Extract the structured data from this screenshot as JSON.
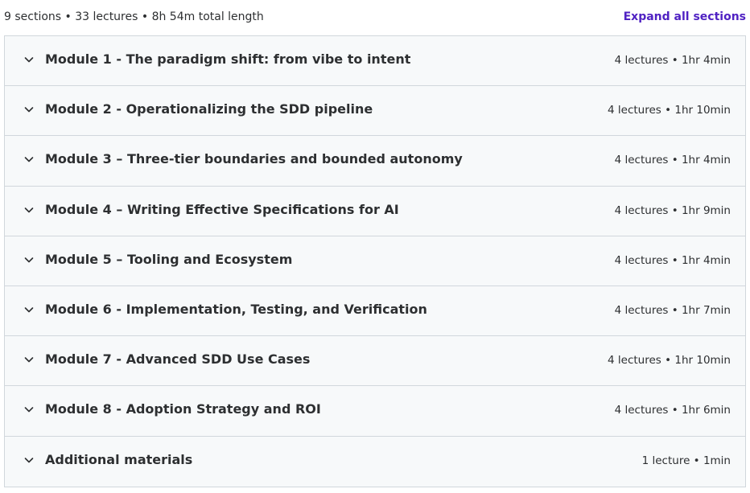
{
  "header": {
    "summary": "9 sections • 33 lectures • 8h 54m total length",
    "expand_all_label": "Expand all sections"
  },
  "sections": [
    {
      "title": "Module 1 - The paradigm shift: from vibe to intent",
      "meta": "4 lectures • 1hr 4min"
    },
    {
      "title": "Module 2 - Operationalizing the SDD pipeline",
      "meta": "4 lectures • 1hr 10min"
    },
    {
      "title": "Module 3 – Three-tier boundaries and bounded autonomy",
      "meta": "4 lectures • 1hr 4min"
    },
    {
      "title": "Module 4 – Writing Effective Specifications for AI",
      "meta": "4 lectures • 1hr 9min"
    },
    {
      "title": "Module 5 – Tooling and Ecosystem",
      "meta": "4 lectures • 1hr 4min"
    },
    {
      "title": "Module 6 - Implementation, Testing, and Verification",
      "meta": "4 lectures • 1hr 7min"
    },
    {
      "title": "Module 7 - Advanced SDD Use Cases",
      "meta": "4 lectures • 1hr 10min"
    },
    {
      "title": "Module 8 - Adoption Strategy and ROI",
      "meta": "4 lectures • 1hr 6min"
    },
    {
      "title": "Additional materials",
      "meta": "1 lecture • 1min"
    }
  ],
  "icons": {
    "section_toggle": "chevron-down-icon"
  },
  "colors": {
    "accent": "#5022c3",
    "row_background": "#f7f9fa",
    "border": "#d1d7dc",
    "text": "#2d2f31"
  }
}
